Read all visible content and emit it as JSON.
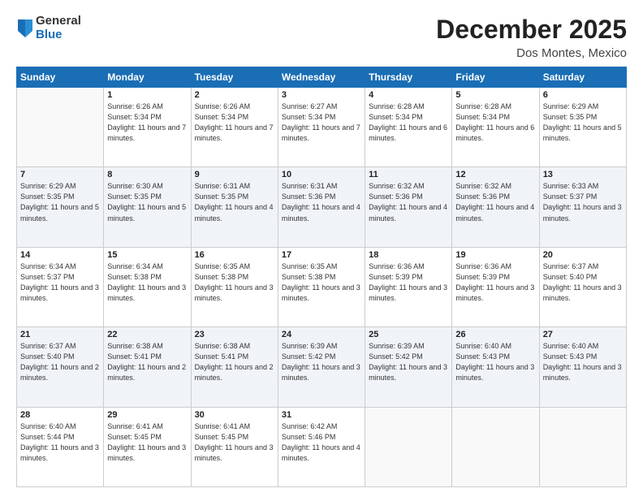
{
  "header": {
    "logo_general": "General",
    "logo_blue": "Blue",
    "month_title": "December 2025",
    "location": "Dos Montes, Mexico"
  },
  "weekdays": [
    "Sunday",
    "Monday",
    "Tuesday",
    "Wednesday",
    "Thursday",
    "Friday",
    "Saturday"
  ],
  "weeks": [
    [
      {
        "day": "",
        "sunrise": "",
        "sunset": "",
        "daylight": ""
      },
      {
        "day": "1",
        "sunrise": "Sunrise: 6:26 AM",
        "sunset": "Sunset: 5:34 PM",
        "daylight": "Daylight: 11 hours and 7 minutes."
      },
      {
        "day": "2",
        "sunrise": "Sunrise: 6:26 AM",
        "sunset": "Sunset: 5:34 PM",
        "daylight": "Daylight: 11 hours and 7 minutes."
      },
      {
        "day": "3",
        "sunrise": "Sunrise: 6:27 AM",
        "sunset": "Sunset: 5:34 PM",
        "daylight": "Daylight: 11 hours and 7 minutes."
      },
      {
        "day": "4",
        "sunrise": "Sunrise: 6:28 AM",
        "sunset": "Sunset: 5:34 PM",
        "daylight": "Daylight: 11 hours and 6 minutes."
      },
      {
        "day": "5",
        "sunrise": "Sunrise: 6:28 AM",
        "sunset": "Sunset: 5:34 PM",
        "daylight": "Daylight: 11 hours and 6 minutes."
      },
      {
        "day": "6",
        "sunrise": "Sunrise: 6:29 AM",
        "sunset": "Sunset: 5:35 PM",
        "daylight": "Daylight: 11 hours and 5 minutes."
      }
    ],
    [
      {
        "day": "7",
        "sunrise": "Sunrise: 6:29 AM",
        "sunset": "Sunset: 5:35 PM",
        "daylight": "Daylight: 11 hours and 5 minutes."
      },
      {
        "day": "8",
        "sunrise": "Sunrise: 6:30 AM",
        "sunset": "Sunset: 5:35 PM",
        "daylight": "Daylight: 11 hours and 5 minutes."
      },
      {
        "day": "9",
        "sunrise": "Sunrise: 6:31 AM",
        "sunset": "Sunset: 5:35 PM",
        "daylight": "Daylight: 11 hours and 4 minutes."
      },
      {
        "day": "10",
        "sunrise": "Sunrise: 6:31 AM",
        "sunset": "Sunset: 5:36 PM",
        "daylight": "Daylight: 11 hours and 4 minutes."
      },
      {
        "day": "11",
        "sunrise": "Sunrise: 6:32 AM",
        "sunset": "Sunset: 5:36 PM",
        "daylight": "Daylight: 11 hours and 4 minutes."
      },
      {
        "day": "12",
        "sunrise": "Sunrise: 6:32 AM",
        "sunset": "Sunset: 5:36 PM",
        "daylight": "Daylight: 11 hours and 4 minutes."
      },
      {
        "day": "13",
        "sunrise": "Sunrise: 6:33 AM",
        "sunset": "Sunset: 5:37 PM",
        "daylight": "Daylight: 11 hours and 3 minutes."
      }
    ],
    [
      {
        "day": "14",
        "sunrise": "Sunrise: 6:34 AM",
        "sunset": "Sunset: 5:37 PM",
        "daylight": "Daylight: 11 hours and 3 minutes."
      },
      {
        "day": "15",
        "sunrise": "Sunrise: 6:34 AM",
        "sunset": "Sunset: 5:38 PM",
        "daylight": "Daylight: 11 hours and 3 minutes."
      },
      {
        "day": "16",
        "sunrise": "Sunrise: 6:35 AM",
        "sunset": "Sunset: 5:38 PM",
        "daylight": "Daylight: 11 hours and 3 minutes."
      },
      {
        "day": "17",
        "sunrise": "Sunrise: 6:35 AM",
        "sunset": "Sunset: 5:38 PM",
        "daylight": "Daylight: 11 hours and 3 minutes."
      },
      {
        "day": "18",
        "sunrise": "Sunrise: 6:36 AM",
        "sunset": "Sunset: 5:39 PM",
        "daylight": "Daylight: 11 hours and 3 minutes."
      },
      {
        "day": "19",
        "sunrise": "Sunrise: 6:36 AM",
        "sunset": "Sunset: 5:39 PM",
        "daylight": "Daylight: 11 hours and 3 minutes."
      },
      {
        "day": "20",
        "sunrise": "Sunrise: 6:37 AM",
        "sunset": "Sunset: 5:40 PM",
        "daylight": "Daylight: 11 hours and 3 minutes."
      }
    ],
    [
      {
        "day": "21",
        "sunrise": "Sunrise: 6:37 AM",
        "sunset": "Sunset: 5:40 PM",
        "daylight": "Daylight: 11 hours and 2 minutes."
      },
      {
        "day": "22",
        "sunrise": "Sunrise: 6:38 AM",
        "sunset": "Sunset: 5:41 PM",
        "daylight": "Daylight: 11 hours and 2 minutes."
      },
      {
        "day": "23",
        "sunrise": "Sunrise: 6:38 AM",
        "sunset": "Sunset: 5:41 PM",
        "daylight": "Daylight: 11 hours and 2 minutes."
      },
      {
        "day": "24",
        "sunrise": "Sunrise: 6:39 AM",
        "sunset": "Sunset: 5:42 PM",
        "daylight": "Daylight: 11 hours and 3 minutes."
      },
      {
        "day": "25",
        "sunrise": "Sunrise: 6:39 AM",
        "sunset": "Sunset: 5:42 PM",
        "daylight": "Daylight: 11 hours and 3 minutes."
      },
      {
        "day": "26",
        "sunrise": "Sunrise: 6:40 AM",
        "sunset": "Sunset: 5:43 PM",
        "daylight": "Daylight: 11 hours and 3 minutes."
      },
      {
        "day": "27",
        "sunrise": "Sunrise: 6:40 AM",
        "sunset": "Sunset: 5:43 PM",
        "daylight": "Daylight: 11 hours and 3 minutes."
      }
    ],
    [
      {
        "day": "28",
        "sunrise": "Sunrise: 6:40 AM",
        "sunset": "Sunset: 5:44 PM",
        "daylight": "Daylight: 11 hours and 3 minutes."
      },
      {
        "day": "29",
        "sunrise": "Sunrise: 6:41 AM",
        "sunset": "Sunset: 5:45 PM",
        "daylight": "Daylight: 11 hours and 3 minutes."
      },
      {
        "day": "30",
        "sunrise": "Sunrise: 6:41 AM",
        "sunset": "Sunset: 5:45 PM",
        "daylight": "Daylight: 11 hours and 3 minutes."
      },
      {
        "day": "31",
        "sunrise": "Sunrise: 6:42 AM",
        "sunset": "Sunset: 5:46 PM",
        "daylight": "Daylight: 11 hours and 4 minutes."
      },
      {
        "day": "",
        "sunrise": "",
        "sunset": "",
        "daylight": ""
      },
      {
        "day": "",
        "sunrise": "",
        "sunset": "",
        "daylight": ""
      },
      {
        "day": "",
        "sunrise": "",
        "sunset": "",
        "daylight": ""
      }
    ]
  ]
}
